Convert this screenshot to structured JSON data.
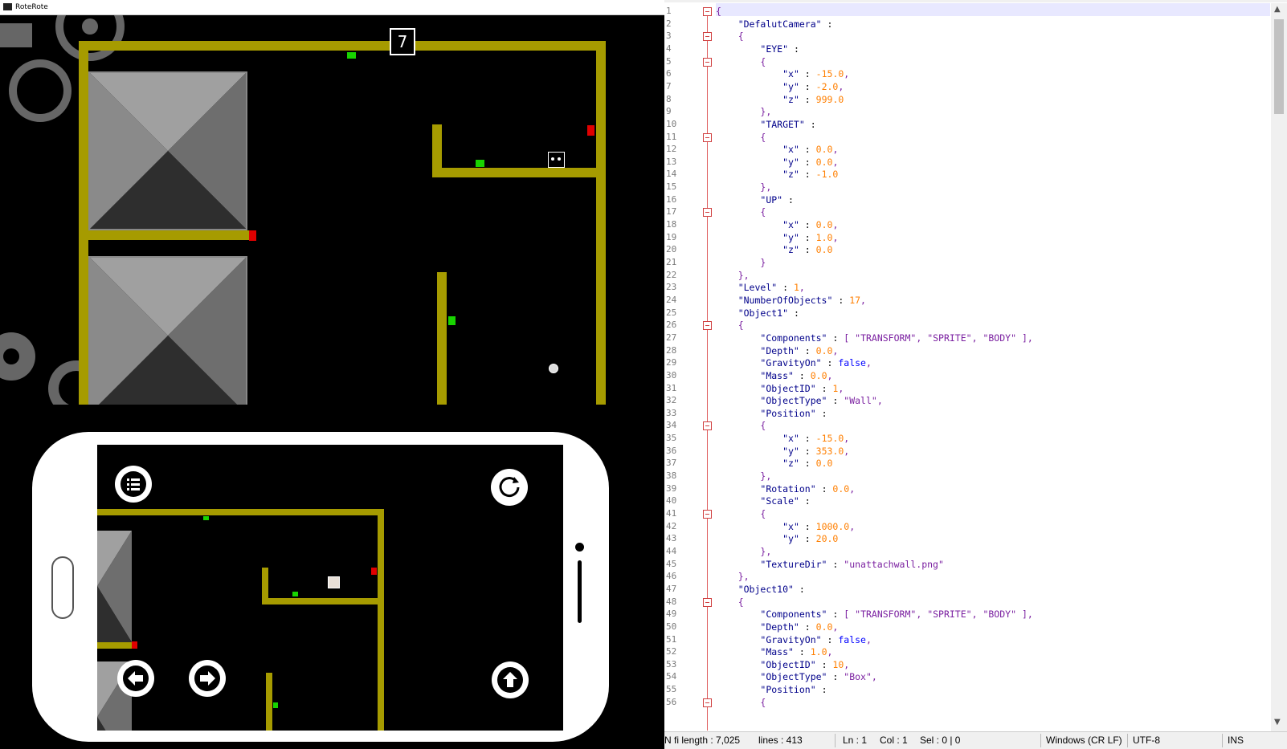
{
  "game": {
    "window_title": "RoteRote",
    "level_number": "7"
  },
  "editor": {
    "status": {
      "length": "N fi length : 7,025",
      "lines": "lines : 413",
      "ln": "Ln : 1",
      "col": "Col : 1",
      "sel": "Sel : 0 | 0",
      "eol": "Windows (CR LF)",
      "encoding": "UTF-8",
      "mode": "INS"
    },
    "lines": [
      "{",
      "    \"DefalutCamera\" :",
      "    {",
      "        \"EYE\" :",
      "        {",
      "            \"x\" : -15.0,",
      "            \"y\" : -2.0,",
      "            \"z\" : 999.0",
      "        },",
      "        \"TARGET\" :",
      "        {",
      "            \"x\" : 0.0,",
      "            \"y\" : 0.0,",
      "            \"z\" : -1.0",
      "        },",
      "        \"UP\" :",
      "        {",
      "            \"x\" : 0.0,",
      "            \"y\" : 1.0,",
      "            \"z\" : 0.0",
      "        }",
      "    },",
      "    \"Level\" : 1,",
      "    \"NumberOfObjects\" : 17,",
      "    \"Object1\" :",
      "    {",
      "        \"Components\" : [ \"TRANSFORM\", \"SPRITE\", \"BODY\" ],",
      "        \"Depth\" : 0.0,",
      "        \"GravityOn\" : false,",
      "        \"Mass\" : 0.0,",
      "        \"ObjectID\" : 1,",
      "        \"ObjectType\" : \"Wall\",",
      "        \"Position\" :",
      "        {",
      "            \"x\" : -15.0,",
      "            \"y\" : 353.0,",
      "            \"z\" : 0.0",
      "        },",
      "        \"Rotation\" : 0.0,",
      "        \"Scale\" :",
      "        {",
      "            \"x\" : 1000.0,",
      "            \"y\" : 20.0",
      "        },",
      "        \"TextureDir\" : \"unattachwall.png\"",
      "    },",
      "    \"Object10\" :",
      "    {",
      "        \"Components\" : [ \"TRANSFORM\", \"SPRITE\", \"BODY\" ],",
      "        \"Depth\" : 0.0,",
      "        \"GravityOn\" : false,",
      "        \"Mass\" : 1.0,",
      "        \"ObjectID\" : 10,",
      "        \"ObjectType\" : \"Box\",",
      "        \"Position\" :",
      "        {"
    ],
    "line_numbers": [
      "1",
      "2",
      "3",
      "4",
      "5",
      "6",
      "7",
      "8",
      "9",
      "10",
      "11",
      "12",
      "13",
      "14",
      "15",
      "16",
      "17",
      "18",
      "19",
      "20",
      "21",
      "22",
      "23",
      "24",
      "25",
      "26",
      "27",
      "28",
      "29",
      "30",
      "31",
      "32",
      "33",
      "34",
      "35",
      "36",
      "37",
      "38",
      "39",
      "40",
      "41",
      "42",
      "43",
      "44",
      "45",
      "46",
      "47",
      "48",
      "49",
      "50",
      "51",
      "52",
      "53",
      "54",
      "55",
      "56"
    ],
    "fold_lines": [
      1,
      3,
      5,
      11,
      17,
      26,
      34,
      41,
      48,
      56
    ]
  }
}
